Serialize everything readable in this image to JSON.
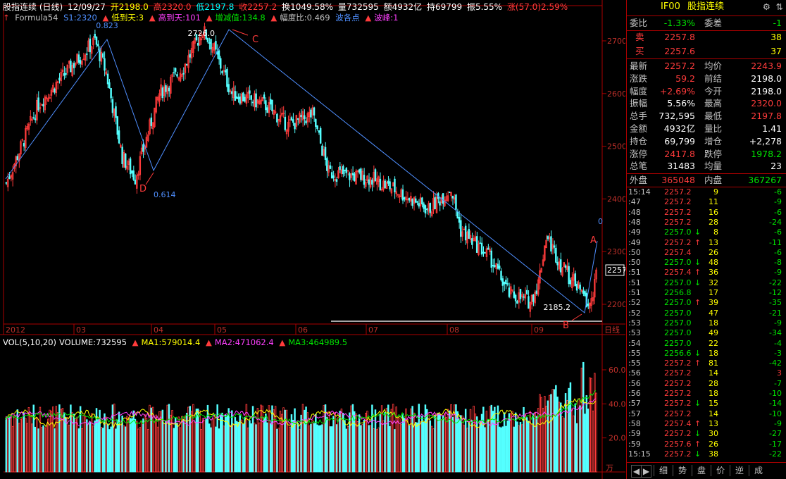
{
  "title_bar": {
    "name": "股指连续 (日线)",
    "date": "12/09/27",
    "open": "开2198.0",
    "high": "高2320.0",
    "low": "低2197.8",
    "close": "收2257.2",
    "turnover": "换1049.58%",
    "volume": "量732595",
    "amount": "额4932亿",
    "position": "持69799",
    "amplitude": "振5.55%",
    "change": "涨(57.0)2.59%"
  },
  "indicator_bar": {
    "name": "Formula54",
    "s1": "S1:2320",
    "low_to_day": "低到天:3",
    "high_to_day": "高到天:101",
    "change_val": "增减值:134.8",
    "ratio": "幅度比:0.469",
    "wave_segment": "波各点",
    "wave_peak": "波峰:1"
  },
  "price_axis": [
    "2700",
    "2600",
    "2500",
    "2400",
    "2300",
    "2200"
  ],
  "price_tag": "2257",
  "time_axis": [
    "2012",
    "03",
    "04",
    "05",
    "06",
    "07",
    "08",
    "09"
  ],
  "period_label": "日线",
  "annotations": {
    "peak_label": "2726.0",
    "trough_label": "2185.2",
    "fib_top": "0.823",
    "fib_low": "0.614",
    "fib_zero": "0",
    "point_c": "C",
    "point_d1": "D",
    "point_a": "A",
    "point_b": "B"
  },
  "volume_bar": {
    "label": "VOL(5,10,20)",
    "volume": "VOLUME:732595",
    "ma1": "MA1:579014.4",
    "ma2": "MA2:471062.4",
    "ma3": "MA3:464989.5"
  },
  "volume_axis": [
    "60.0",
    "40.0",
    "20.0"
  ],
  "volume_unit": "万",
  "colors": {
    "up": "#ff3b3b",
    "down": "#54ffff",
    "ma1": "#ffff00",
    "ma2": "#ff40ff",
    "ma3": "#00e600",
    "line": "#4f8fff"
  },
  "panel": {
    "code": "IF00",
    "name": "股指连续",
    "weibi_label": "委比",
    "weibi": "-1.33%",
    "weicha_label": "委差",
    "weicha": "-1",
    "sell_label": "卖",
    "sell_price": "2257.8",
    "sell_vol": "38",
    "buy_label": "买",
    "buy_price": "2257.6",
    "buy_vol": "37",
    "stats": [
      {
        "l1": "最新",
        "v1": "2257.2",
        "c1": "red",
        "l2": "均价",
        "v2": "2243.9",
        "c2": "red"
      },
      {
        "l1": "涨跌",
        "v1": "59.2",
        "c1": "red",
        "l2": "前结",
        "v2": "2198.0",
        "c2": "wht"
      },
      {
        "l1": "幅度",
        "v1": "+2.69%",
        "c1": "red",
        "l2": "今开",
        "v2": "2198.0",
        "c2": "wht"
      },
      {
        "l1": "振幅",
        "v1": "5.56%",
        "c1": "wht",
        "l2": "最高",
        "v2": "2320.0",
        "c2": "red"
      },
      {
        "l1": "总手",
        "v1": "732,595",
        "c1": "wht",
        "l2": "最低",
        "v2": "2197.8",
        "c2": "red"
      },
      {
        "l1": "金额",
        "v1": "4932亿",
        "c1": "wht",
        "l2": "量比",
        "v2": "1.41",
        "c2": "wht"
      },
      {
        "l1": "持仓",
        "v1": "69,799",
        "c1": "wht",
        "l2": "增仓",
        "v2": "+2,278",
        "c2": "wht"
      },
      {
        "l1": "涨停",
        "v1": "2417.8",
        "c1": "red",
        "l2": "跌停",
        "v2": "1978.2",
        "c2": "grn"
      },
      {
        "l1": "总笔",
        "v1": "31483",
        "c1": "wht",
        "l2": "均量",
        "v2": "23",
        "c2": "wht"
      }
    ],
    "outer_label": "外盘",
    "outer": "365048",
    "inner_label": "内盘",
    "inner": "367267",
    "ticks": [
      {
        "t": "15:14",
        "p": "2257.2",
        "a": "",
        "v": "9",
        "c": "-6",
        "cc": "grn"
      },
      {
        "t": ":47",
        "p": "2257.2",
        "a": "",
        "v": "11",
        "c": "-9",
        "cc": "grn"
      },
      {
        "t": ":48",
        "p": "2257.2",
        "a": "",
        "v": "16",
        "c": "-6",
        "cc": "grn"
      },
      {
        "t": ":48",
        "p": "2257.2",
        "a": "",
        "v": "28",
        "c": "-24",
        "cc": "grn"
      },
      {
        "t": ":49",
        "p": "2257.0",
        "a": "↓",
        "v": "8",
        "c": "-6",
        "cc": "grn"
      },
      {
        "t": ":49",
        "p": "2257.2",
        "a": "↑",
        "v": "13",
        "c": "-11",
        "cc": "grn"
      },
      {
        "t": ":50",
        "p": "2257.4",
        "a": "",
        "v": "26",
        "c": "-6",
        "cc": "grn"
      },
      {
        "t": ":50",
        "p": "2257.0",
        "a": "↓",
        "v": "48",
        "c": "-8",
        "cc": "grn"
      },
      {
        "t": ":51",
        "p": "2257.4",
        "a": "↑",
        "v": "36",
        "c": "-9",
        "cc": "grn"
      },
      {
        "t": ":51",
        "p": "2257.0",
        "a": "↓",
        "v": "32",
        "c": "-22",
        "cc": "grn"
      },
      {
        "t": ":51",
        "p": "2256.8",
        "a": "",
        "v": "17",
        "c": "-12",
        "cc": "grn"
      },
      {
        "t": ":52",
        "p": "2257.0",
        "a": "↑",
        "v": "39",
        "c": "-35",
        "cc": "grn"
      },
      {
        "t": ":52",
        "p": "2257.0",
        "a": "",
        "v": "47",
        "c": "-21",
        "cc": "grn"
      },
      {
        "t": ":53",
        "p": "2257.0",
        "a": "",
        "v": "18",
        "c": "-9",
        "cc": "grn"
      },
      {
        "t": ":53",
        "p": "2257.0",
        "a": "",
        "v": "49",
        "c": "-34",
        "cc": "grn"
      },
      {
        "t": ":54",
        "p": "2257.0",
        "a": "",
        "v": "22",
        "c": "-4",
        "cc": "grn"
      },
      {
        "t": ":55",
        "p": "2256.6",
        "a": "↓",
        "v": "18",
        "c": "-3",
        "cc": "grn"
      },
      {
        "t": ":55",
        "p": "2257.2",
        "a": "↑",
        "v": "81",
        "c": "-42",
        "cc": "grn"
      },
      {
        "t": ":56",
        "p": "2257.2",
        "a": "",
        "v": "14",
        "c": "3",
        "cc": "red"
      },
      {
        "t": ":56",
        "p": "2257.2",
        "a": "",
        "v": "28",
        "c": "-7",
        "cc": "grn"
      },
      {
        "t": ":56",
        "p": "2257.2",
        "a": "",
        "v": "18",
        "c": "-10",
        "cc": "grn"
      },
      {
        "t": ":57",
        "p": "2257.2",
        "a": "↓",
        "v": "15",
        "c": "-14",
        "cc": "grn"
      },
      {
        "t": ":57",
        "p": "2257.2",
        "a": "",
        "v": "14",
        "c": "-10",
        "cc": "grn"
      },
      {
        "t": ":58",
        "p": "2257.4",
        "a": "↑",
        "v": "13",
        "c": "-9",
        "cc": "grn"
      },
      {
        "t": ":59",
        "p": "2257.2",
        "a": "↓",
        "v": "30",
        "c": "-27",
        "cc": "grn"
      },
      {
        "t": ":59",
        "p": "2257.6",
        "a": "↑",
        "v": "26",
        "c": "-17",
        "cc": "grn"
      },
      {
        "t": "15:15",
        "p": "2257.2",
        "a": "↓",
        "v": "38",
        "c": "-22",
        "cc": "grn"
      }
    ],
    "tabs": [
      "细",
      "势",
      "盘",
      "价",
      "逆",
      "成"
    ]
  }
}
